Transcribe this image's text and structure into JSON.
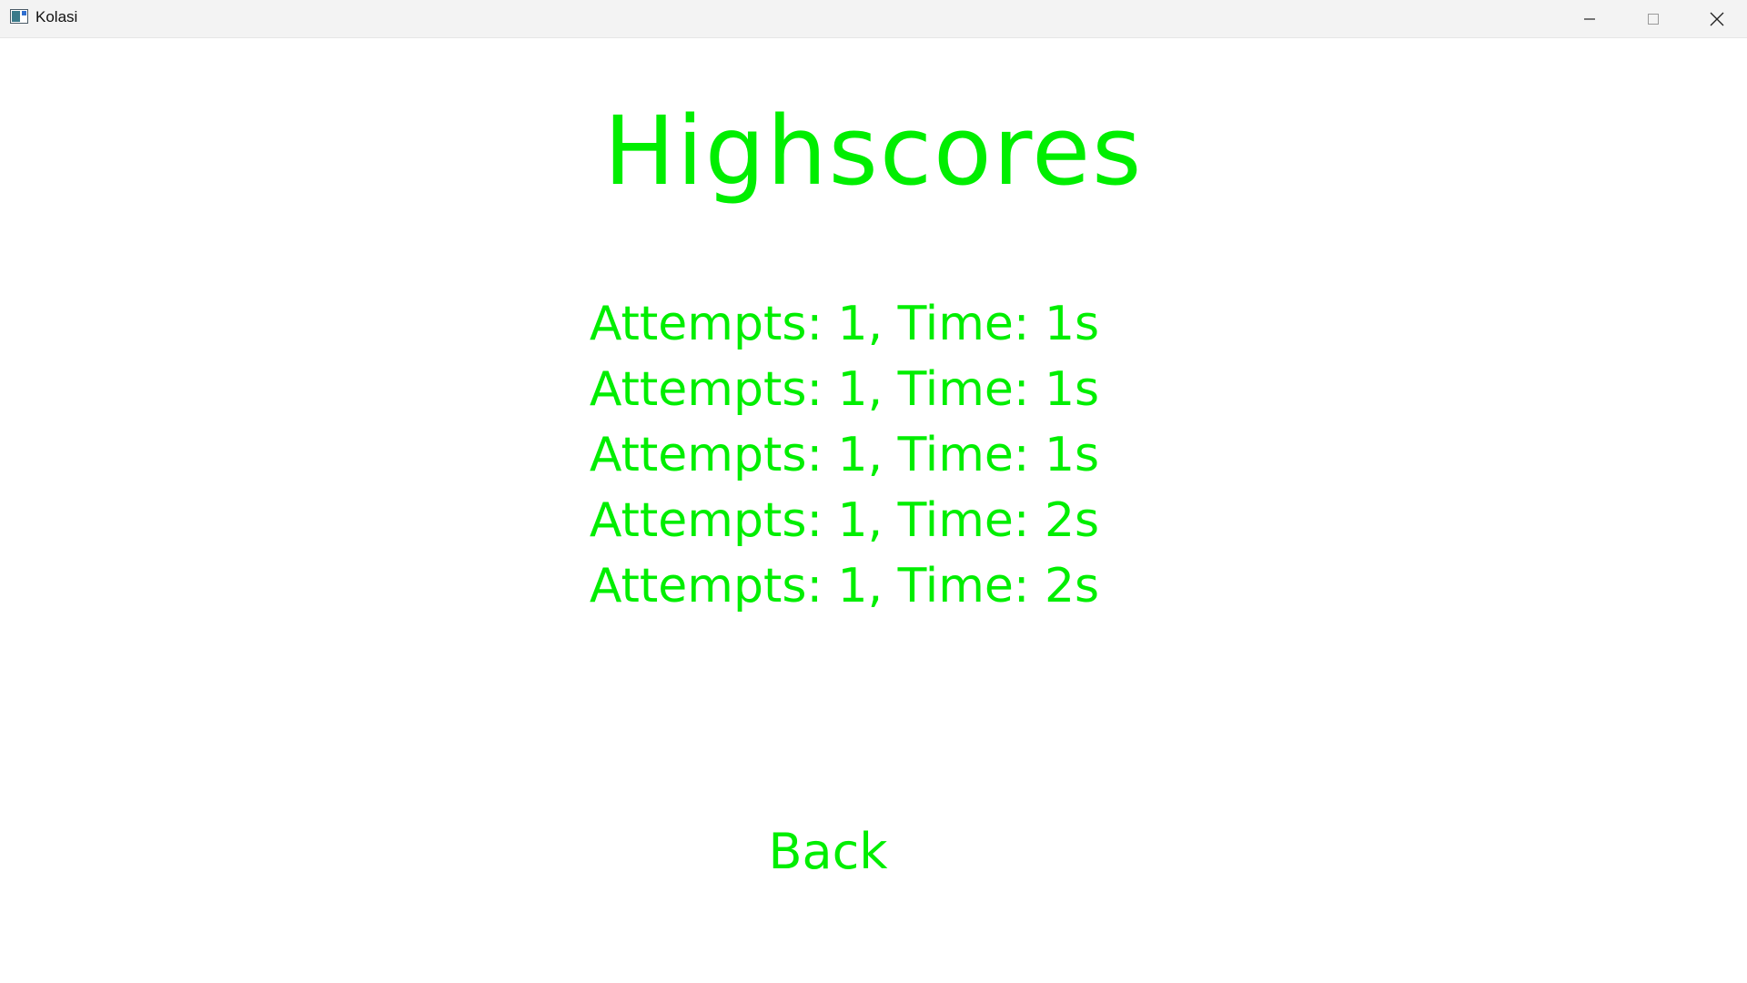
{
  "window": {
    "title": "Kolasi",
    "controls": {
      "minimize_icon": "minimize-icon",
      "maximize_icon": "maximize-icon",
      "close_icon": "close-icon"
    }
  },
  "screen": {
    "heading": "Highscores",
    "scores": [
      "Attempts: 1, Time: 1s",
      "Attempts: 1, Time: 1s",
      "Attempts: 1, Time: 1s",
      "Attempts: 1, Time: 2s",
      "Attempts: 1, Time: 2s"
    ],
    "back_label": "Back"
  },
  "colors": {
    "accent": "#00ee00",
    "background": "#ffffff",
    "titlebar": "#f3f3f3"
  }
}
